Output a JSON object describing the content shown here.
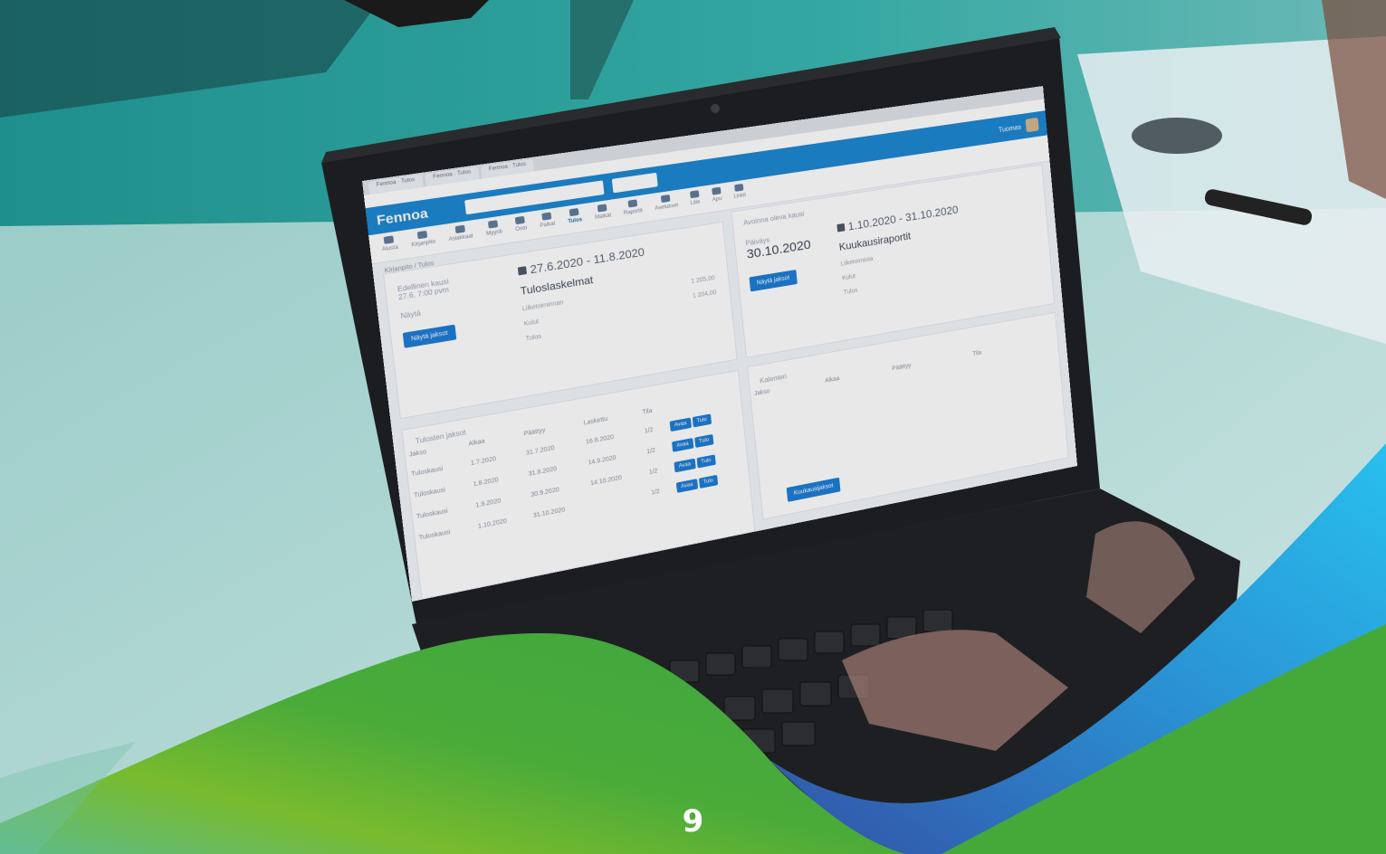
{
  "page_number": "9",
  "app": {
    "browser_tabs": [
      "Fennoa · Tulos",
      "Fennoa · Tulos",
      "Fennoa · Tulos"
    ],
    "address": "",
    "logo": "Fennoa",
    "user_label": "Tuomas",
    "nav_items": [
      "Alusta",
      "Kirjanpito",
      "Asiakkaat",
      "Myynti",
      "Osto",
      "Palkat",
      "Tulos",
      "Matkat",
      "Raportit",
      "Asetukset",
      "Liite",
      "Apu",
      "Linkit"
    ],
    "nav_selected": "Tulos",
    "breadcrumb": "Kirjanpito / Tulos",
    "left_panel": {
      "kicker": "Edellinen kausi",
      "kicker_sub": "27.6. 7:00 pvm",
      "link": "Näytä",
      "button": "Näytä jaksot",
      "range": "27.6.2020 - 11.8.2020",
      "heading": "Tuloslaskelmat",
      "rows": [
        {
          "label": "Liiketoiminnan",
          "value": "1 205,00"
        },
        {
          "label": "Kulut",
          "value": "1 204,00"
        },
        {
          "label": "Tulos",
          "value": ""
        }
      ]
    },
    "right_panel": {
      "kicker": "Avoinna oleva kausi",
      "date_label": "Päiväys",
      "date": "30.10.2020",
      "date_sub": "",
      "button": "Näytä jaksot",
      "range": "1.10.2020 - 31.10.2020",
      "heading": "Kuukausiraportit",
      "rows": [
        {
          "label": "Liiketoiminta",
          "value": ""
        },
        {
          "label": "Kulut",
          "value": ""
        },
        {
          "label": "Tulos",
          "value": ""
        }
      ]
    },
    "table_panel": {
      "title": "Tulosten jaksot",
      "columns": [
        "Jakso",
        "Alkaa",
        "Päättyy",
        "Laskettu",
        "Tila",
        ""
      ],
      "rows": [
        {
          "cells": [
            "Tuloskausi",
            "1.7.2020",
            "31.7.2020",
            "16.8.2020",
            "1/2"
          ]
        },
        {
          "cells": [
            "Tuloskausi",
            "1.8.2020",
            "31.8.2020",
            "14.9.2020",
            "1/2"
          ]
        },
        {
          "cells": [
            "Tuloskausi",
            "1.9.2020",
            "30.9.2020",
            "14.10.2020",
            "1/2"
          ]
        },
        {
          "cells": [
            "Tuloskausi",
            "1.10.2020",
            "31.10.2020",
            "",
            "1/2"
          ]
        }
      ],
      "row_button_a": "Avaa",
      "row_button_b": "Tulo"
    },
    "grid_panel": {
      "title": "Kalenteri",
      "columns": [
        "Jakso",
        "Alkaa",
        "Päättyy",
        "Tila",
        "",
        ""
      ],
      "button": "Kuukausijaksot"
    }
  },
  "colors": {
    "teal_wall": "#2a9b96",
    "green_wave": "#49a936",
    "blue_wave": "#2b9fe0",
    "app_blue": "#1a86d0"
  }
}
